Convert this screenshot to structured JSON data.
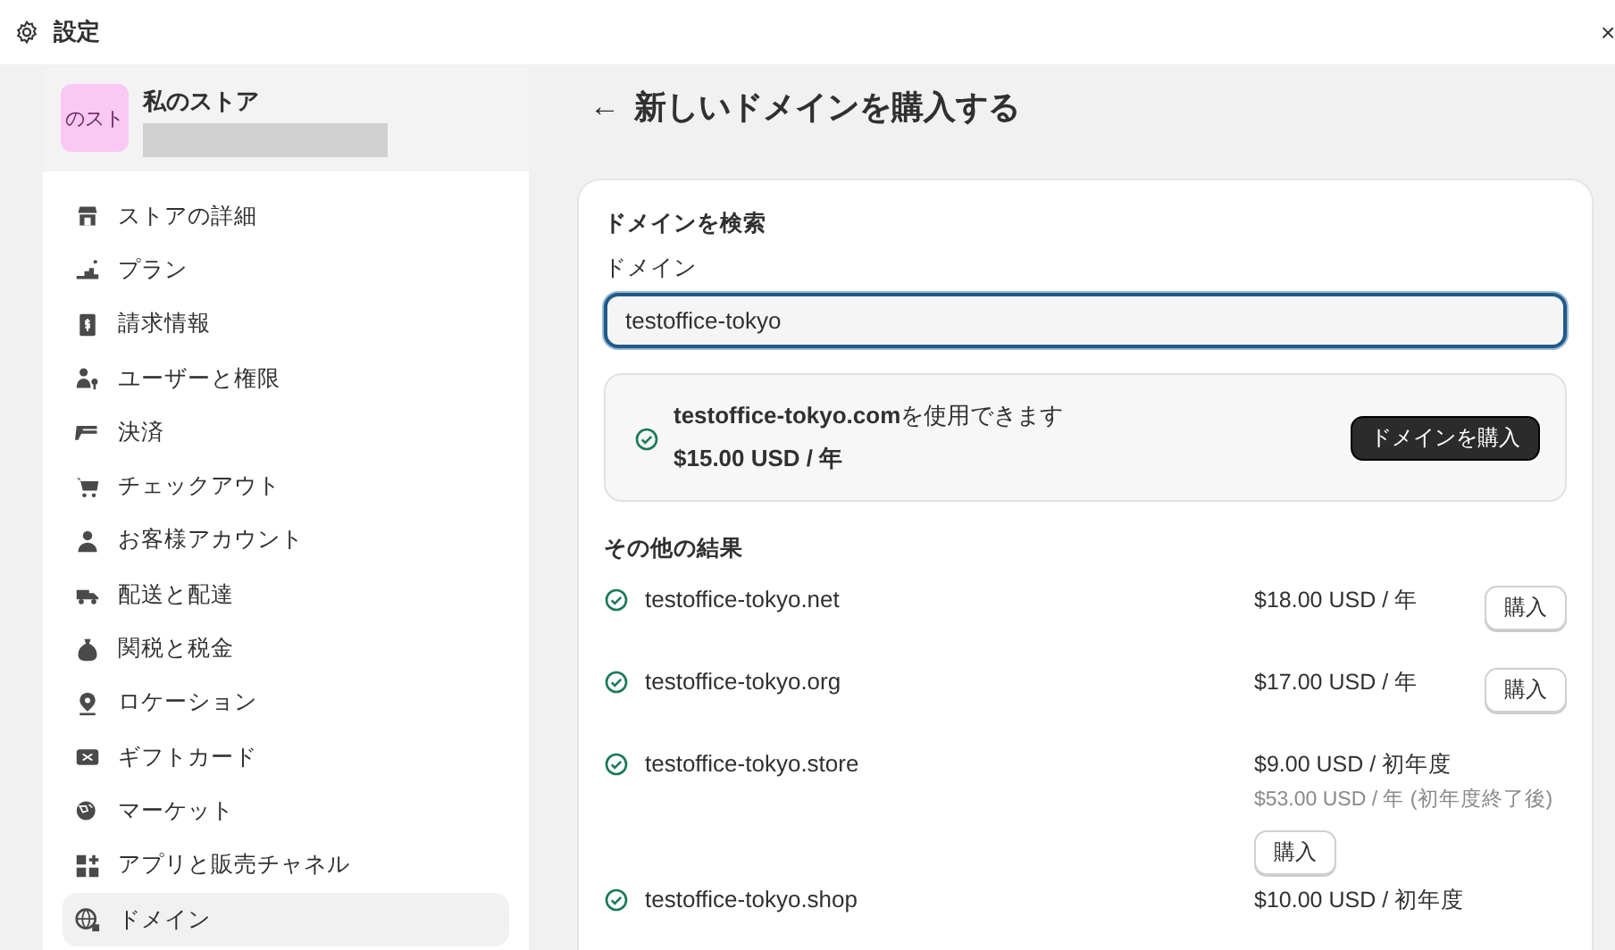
{
  "window": {
    "title": "設定",
    "close": "×"
  },
  "sidebar": {
    "store": {
      "avatar": "のスト",
      "name": "私のストア"
    },
    "items": [
      {
        "label": "ストアの詳細",
        "selected": false
      },
      {
        "label": "プラン",
        "selected": false
      },
      {
        "label": "請求情報",
        "selected": false
      },
      {
        "label": "ユーザーと権限",
        "selected": false
      },
      {
        "label": "決済",
        "selected": false
      },
      {
        "label": "チェックアウト",
        "selected": false
      },
      {
        "label": "お客様アカウント",
        "selected": false
      },
      {
        "label": "配送と配達",
        "selected": false
      },
      {
        "label": "関税と税金",
        "selected": false
      },
      {
        "label": "ロケーション",
        "selected": false
      },
      {
        "label": "ギフトカード",
        "selected": false
      },
      {
        "label": "マーケット",
        "selected": false
      },
      {
        "label": "アプリと販売チャネル",
        "selected": false
      },
      {
        "label": "ドメイン",
        "selected": true
      }
    ]
  },
  "page": {
    "back": "←",
    "title": "新しいドメインを購入する"
  },
  "search": {
    "heading": "ドメインを検索",
    "label": "ドメイン",
    "value": "testoffice-tokyo"
  },
  "available": {
    "domain": "testoffice-tokyo.com",
    "message": "を使用できます",
    "price": "$15.00 USD / 年",
    "button": "ドメインを購入"
  },
  "results": {
    "heading": "その他の結果",
    "rows": [
      {
        "domain": "testoffice-tokyo.net",
        "price": "$18.00 USD / 年",
        "button": "購入"
      },
      {
        "domain": "testoffice-tokyo.org",
        "price": "$17.00 USD / 年",
        "button": "購入"
      },
      {
        "domain": "testoffice-tokyo.store",
        "price": "$9.00 USD / 初年度",
        "note": "$53.00 USD / 年 (初年度終了後)",
        "button": "購入"
      },
      {
        "domain": "testoffice-tokyo.shop",
        "price": "$10.00 USD / 初年度"
      }
    ]
  }
}
